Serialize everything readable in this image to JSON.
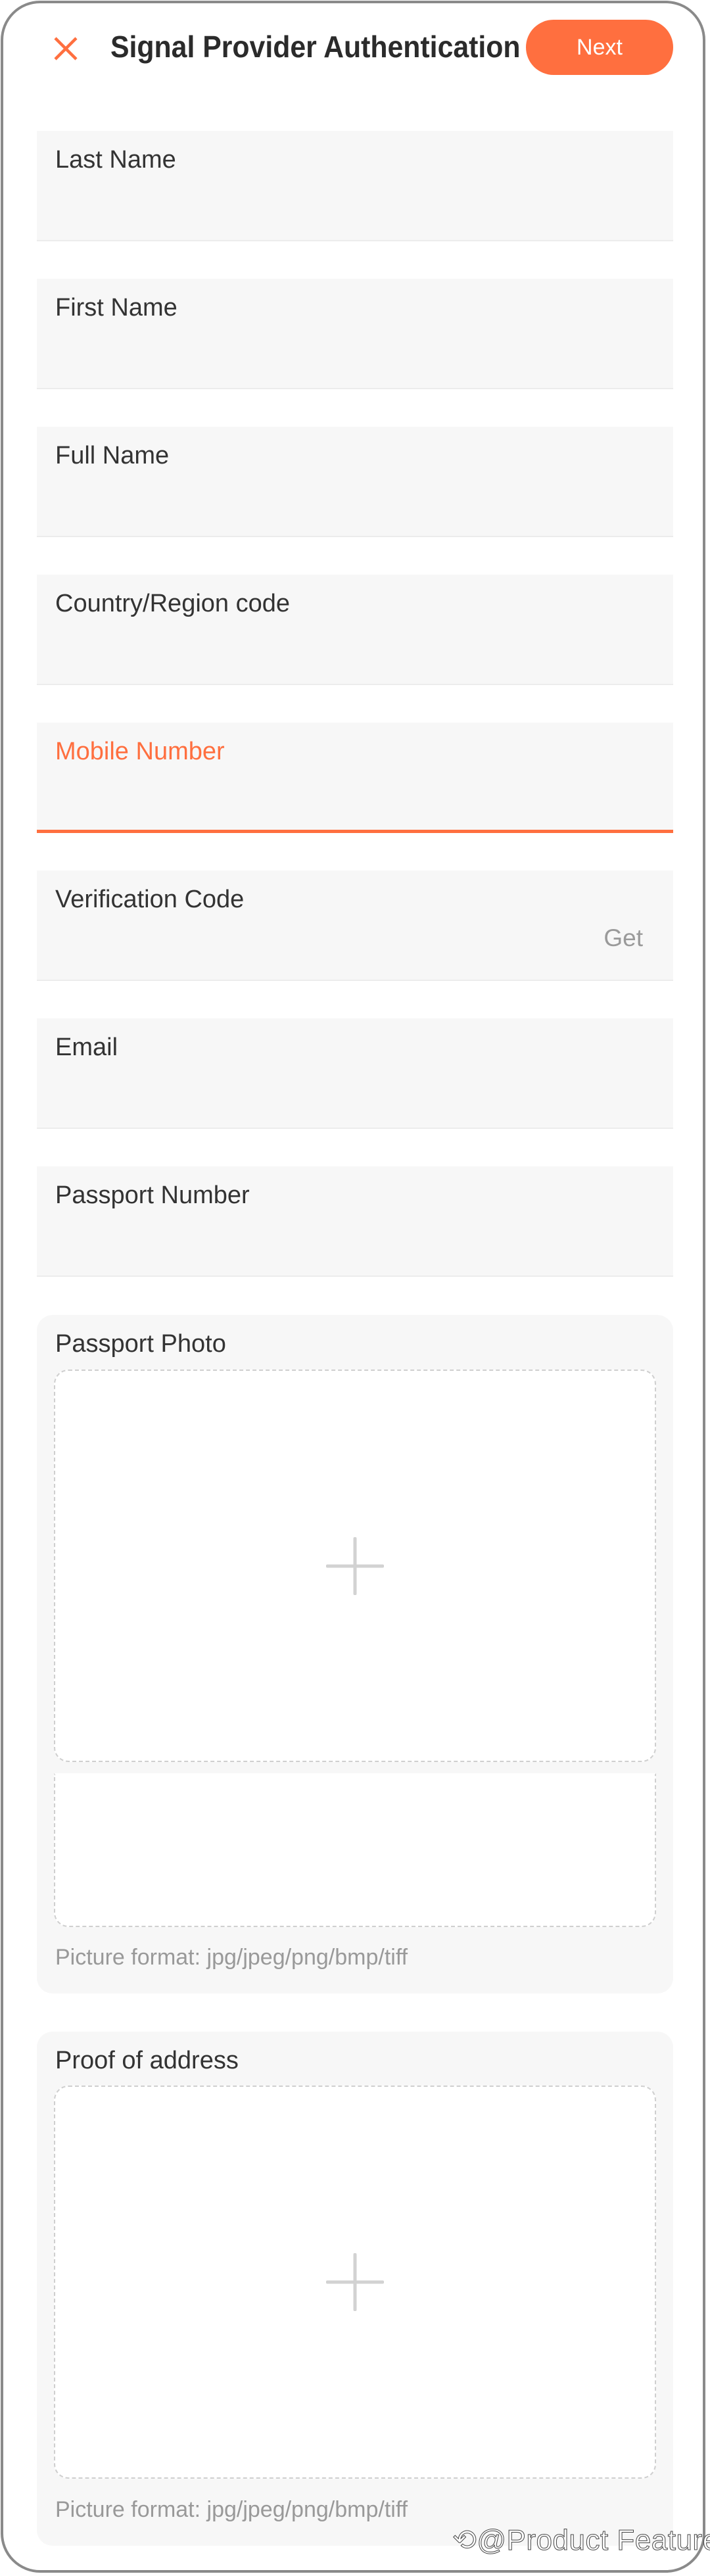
{
  "header": {
    "title": "Signal Provider Authentication",
    "next_label": "Next",
    "close_icon": "close-icon"
  },
  "colors": {
    "accent": "#ff6f3f",
    "field_bg": "#f7f7f7",
    "text": "#333333",
    "muted": "#999999"
  },
  "form": {
    "fields": [
      {
        "label": "Last Name",
        "value": ""
      },
      {
        "label": "First Name",
        "value": ""
      },
      {
        "label": "Full Name",
        "value": ""
      },
      {
        "label": "Country/Region code",
        "value": ""
      },
      {
        "label": "Mobile Number",
        "value": "",
        "focused": true
      },
      {
        "label": "Verification Code",
        "value": "",
        "action": "Get"
      },
      {
        "label": "Email",
        "value": ""
      },
      {
        "label": "Passport Number",
        "value": ""
      }
    ],
    "uploads": [
      {
        "label": "Passport Photo",
        "hint": "Picture format: jpg/jpeg/png/bmp/tiff",
        "icon": "plus-icon"
      },
      {
        "label": "Proof of address",
        "hint": "Picture format: jpg/jpeg/png/bmp/tiff",
        "icon": "plus-icon"
      }
    ]
  },
  "watermark": "@Product Features"
}
